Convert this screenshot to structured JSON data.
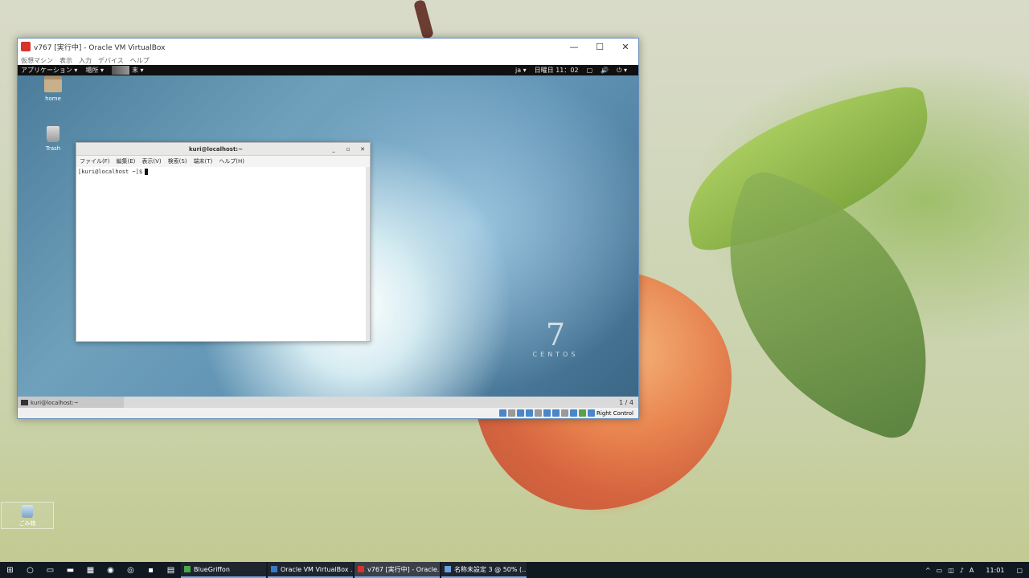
{
  "vbox": {
    "title": "v767 [実行中] - Oracle VM VirtualBox",
    "menu": [
      "仮想マシン",
      "表示",
      "入力",
      "デバイス",
      "ヘルプ"
    ],
    "window_controls": [
      "—",
      "☐",
      "✕"
    ],
    "status_host_key": "Right Control"
  },
  "gnome": {
    "applications_label": "アプリケーション ▾",
    "places_label": "場所 ▾",
    "terminal_label": "末 ▾",
    "lang": "ja ▾",
    "clock": "日曜日 11：02",
    "bottom_task": "kuri@localhost:~",
    "workspace": "1 / 4",
    "brand_number": "7",
    "brand_name": "CENTOS"
  },
  "desktop_icons": {
    "home": "home",
    "trash": "Trash"
  },
  "terminal": {
    "title": "kuri@localhost:~",
    "menu": [
      "ファイル(F)",
      "編集(E)",
      "表示(V)",
      "検索(S)",
      "端末(T)",
      "ヘルプ(H)"
    ],
    "prompt": "[kuri@localhost ~]$"
  },
  "host_desktop": {
    "recycle_bin": "ごみ箱"
  },
  "taskbar": {
    "apps": [
      {
        "label": "BlueGriffon",
        "color": "#4aa84a"
      },
      {
        "label": "Oracle VM VirtualBox ...",
        "color": "#3a78c8"
      },
      {
        "label": "v767 [実行中] - Oracle...",
        "color": "#d6342c"
      },
      {
        "label": "名称未設定 3 @ 50% (...",
        "color": "#6aa0e0"
      }
    ],
    "tray_input": "A",
    "clock": "11:01"
  },
  "colors": {
    "taskbar_bg": "#101822",
    "gnome_top_bg": "#101010",
    "accent": "#7aa9e0"
  }
}
